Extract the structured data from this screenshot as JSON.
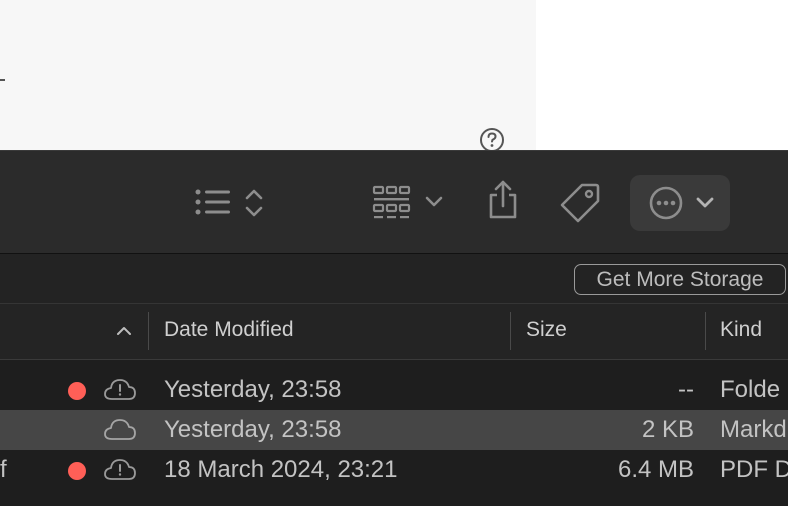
{
  "toolbar": {
    "list_view_icon": "list-icon",
    "sort_toggle_icon": "up-down-chevrons-icon",
    "group_icon": "grid-icon",
    "share_icon": "share-icon",
    "tag_icon": "tag-icon",
    "more_icon": "ellipsis-circle-icon"
  },
  "storage": {
    "button_label": "Get More Storage"
  },
  "columns": {
    "date_modified": "Date Modified",
    "size": "Size",
    "kind": "Kind"
  },
  "rows": [
    {
      "lead": "",
      "tag_color": "#ff5f57",
      "cloud_status": "cloud-warning",
      "date": "Yesterday, 23:58",
      "size": "--",
      "kind": "Folde"
    },
    {
      "lead": "",
      "tag_color": "",
      "cloud_status": "cloud",
      "date": "Yesterday, 23:58",
      "size": "2 KB",
      "kind": "Markd"
    },
    {
      "lead": "f",
      "tag_color": "#ff5f57",
      "cloud_status": "cloud-warning",
      "date": "18 March 2024, 23:21",
      "size": "6.4 MB",
      "kind": "PDF D"
    }
  ]
}
